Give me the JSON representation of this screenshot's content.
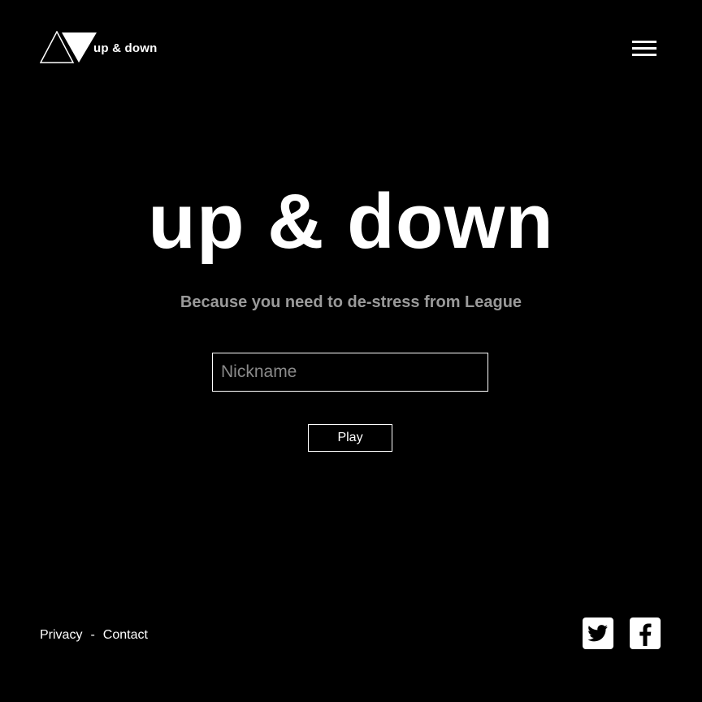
{
  "header": {
    "logo_text": "up & down",
    "menu_icon": "hamburger-menu-icon"
  },
  "hero": {
    "title": "up & down",
    "tagline": "Because you need to de-stress from League"
  },
  "form": {
    "nickname_placeholder": "Nickname",
    "nickname_value": "",
    "play_label": "Play"
  },
  "footer": {
    "privacy_label": "Privacy",
    "separator": "-",
    "contact_label": "Contact",
    "social": [
      {
        "icon": "twitter-icon"
      },
      {
        "icon": "facebook-icon"
      }
    ]
  },
  "colors": {
    "background": "#000000",
    "text": "#ffffff",
    "muted": "#9a9a9a"
  }
}
